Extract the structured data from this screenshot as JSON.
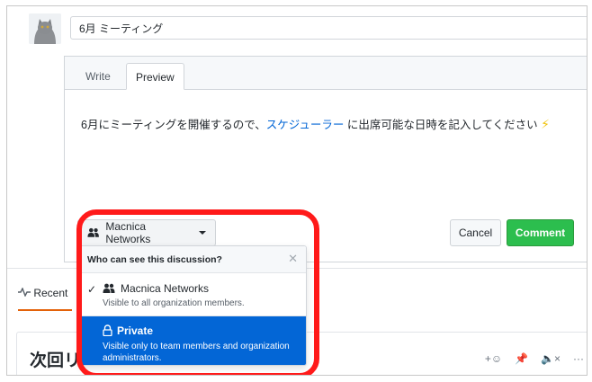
{
  "discussion": {
    "title_value": "6月 ミーティング"
  },
  "editor": {
    "tabs": [
      {
        "label": "Write",
        "active": false
      },
      {
        "label": "Preview",
        "active": true
      }
    ],
    "preview_text_before": "6月にミーティングを開催するので、",
    "preview_link": "スケジューラー",
    "preview_text_after": "に出席可能な日時を記入してください",
    "preview_emoji": "⚡"
  },
  "visibility": {
    "button_label": "Macnica Networks",
    "dropdown_title": "Who can see this discussion?",
    "options": [
      {
        "name": "Macnica Networks",
        "description": "Visible to all organization members.",
        "selected": true,
        "icon": "people-icon"
      },
      {
        "name": "Private",
        "description": "Visible only to team members and organization administrators.",
        "selected": false,
        "highlighted": true,
        "icon": "lock-icon"
      }
    ]
  },
  "actions": {
    "cancel_label": "Cancel",
    "comment_label": "Comment"
  },
  "recent": {
    "label": "Recent"
  },
  "card": {
    "title": "次回リ"
  },
  "colors": {
    "comment_green": "#2cbe4e",
    "selected_blue": "#0366d6",
    "link_blue": "#0366d6",
    "highlight_red": "#ff1a1a",
    "tab_underline": "#e36209"
  }
}
